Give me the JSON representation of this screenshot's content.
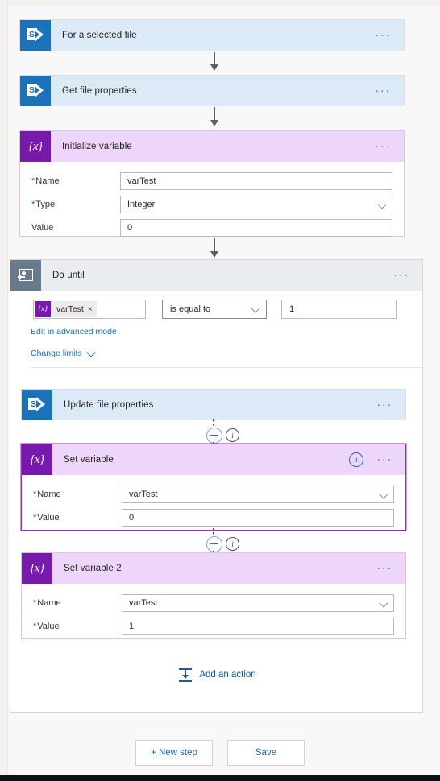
{
  "theme": {
    "sharepoint_blue": "#1b72b8",
    "variable_purple": "#7719aa",
    "loop_gray": "#697a8c",
    "link_blue": "#1b6bbd",
    "required_red": "#b4303b",
    "connector_red": "#a4262c",
    "selected_border": "#9a2ec4"
  },
  "steps": {
    "trigger": {
      "title": "For a selected file",
      "icon": "sharepoint-icon",
      "menu": "···"
    },
    "get_file_properties": {
      "title": "Get file properties",
      "icon": "sharepoint-icon",
      "menu": "···"
    },
    "initialize_variable": {
      "title": "Initialize variable",
      "icon": "variable-icon",
      "menu": "···",
      "fields": [
        {
          "label": "Name",
          "required": true,
          "value": "varTest",
          "control": "text"
        },
        {
          "label": "Type",
          "required": true,
          "value": "Integer",
          "control": "dropdown"
        },
        {
          "label": "Value",
          "required": false,
          "value": "0",
          "control": "text"
        }
      ]
    },
    "do_until": {
      "title": "Do until",
      "icon": "loop-icon",
      "menu": "···",
      "condition": {
        "token_label": "varTest",
        "token_glyph": "{x}",
        "token_remove": "×",
        "operator": "is equal to",
        "value": "1"
      },
      "advanced_link": "Edit in advanced mode",
      "limits_link": "Change limits",
      "children": {
        "update_file_properties": {
          "title": "Update file properties",
          "icon": "sharepoint-icon",
          "menu": "···"
        },
        "set_variable": {
          "title": "Set variable",
          "icon": "variable-icon",
          "menu": "···",
          "info": "i",
          "selected": true,
          "fields": [
            {
              "label": "Name",
              "required": true,
              "value": "varTest",
              "control": "dropdown"
            },
            {
              "label": "Value",
              "required": true,
              "value": "0",
              "control": "text"
            }
          ]
        },
        "set_variable_2": {
          "title": "Set variable 2",
          "icon": "variable-icon",
          "menu": "···",
          "fields": [
            {
              "label": "Name",
              "required": true,
              "value": "varTest",
              "control": "dropdown"
            },
            {
              "label": "Value",
              "required": true,
              "value": "1",
              "control": "text"
            }
          ]
        }
      },
      "add_action": {
        "label": "Add an action",
        "icon": "insert-action-icon"
      }
    }
  },
  "connectors": {
    "insert_plus": "+",
    "insert_info": "i"
  },
  "footer": {
    "new_step": "+ New step",
    "save": "Save"
  }
}
